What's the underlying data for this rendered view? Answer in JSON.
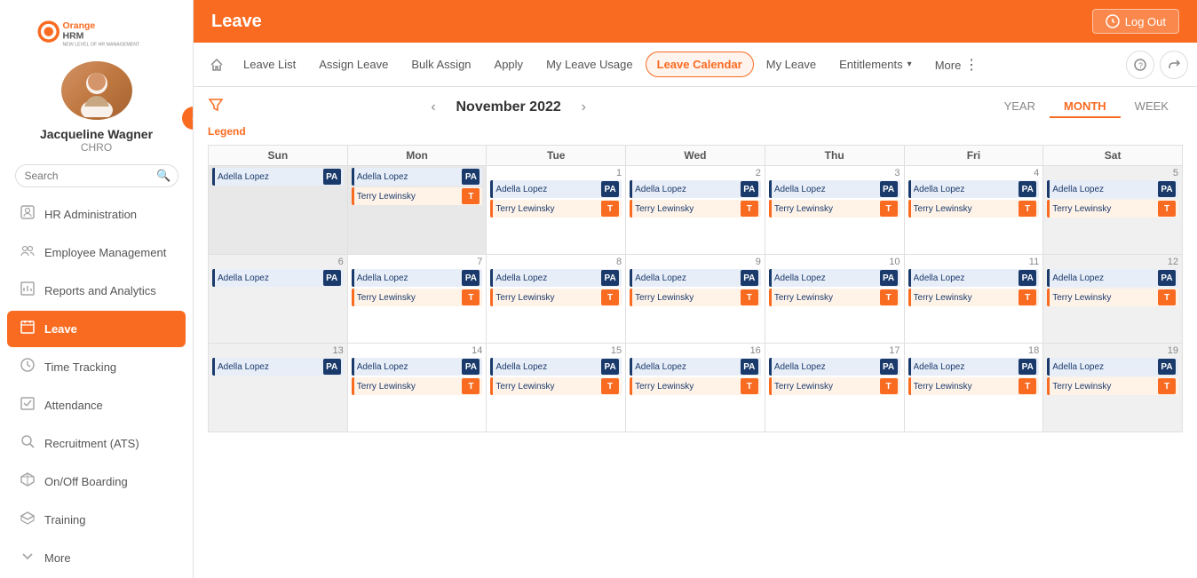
{
  "app": {
    "title": "Leave",
    "logo_text": "OrangeHRM"
  },
  "header": {
    "logout_label": "Log Out"
  },
  "user": {
    "name": "Jacqueline Wagner",
    "role": "CHRO"
  },
  "search": {
    "placeholder": "Search"
  },
  "nav": {
    "items": [
      {
        "id": "hr-admin",
        "label": "HR Administration",
        "icon": "🏠"
      },
      {
        "id": "emp-mgmt",
        "label": "Employee Management",
        "icon": "👥"
      },
      {
        "id": "reports",
        "label": "Reports and Analytics",
        "icon": "📊"
      },
      {
        "id": "leave",
        "label": "Leave",
        "icon": "📅"
      },
      {
        "id": "time",
        "label": "Time Tracking",
        "icon": "⏱"
      },
      {
        "id": "attendance",
        "label": "Attendance",
        "icon": "📋"
      },
      {
        "id": "recruitment",
        "label": "Recruitment (ATS)",
        "icon": "🔍"
      },
      {
        "id": "onboarding",
        "label": "On/Off Boarding",
        "icon": "🔄"
      },
      {
        "id": "training",
        "label": "Training",
        "icon": "🎓"
      },
      {
        "id": "more",
        "label": "More",
        "icon": "⌄"
      }
    ]
  },
  "tabs": {
    "items": [
      {
        "id": "leave-list",
        "label": "Leave List"
      },
      {
        "id": "assign-leave",
        "label": "Assign Leave"
      },
      {
        "id": "bulk-assign",
        "label": "Bulk Assign"
      },
      {
        "id": "apply",
        "label": "Apply"
      },
      {
        "id": "my-leave-usage",
        "label": "My Leave Usage"
      },
      {
        "id": "leave-calendar",
        "label": "Leave Calendar"
      },
      {
        "id": "my-leave",
        "label": "My Leave"
      },
      {
        "id": "entitlements",
        "label": "Entitlements"
      },
      {
        "id": "more",
        "label": "More"
      }
    ]
  },
  "calendar": {
    "month_label": "November 2022",
    "legend_label": "Legend",
    "views": [
      "YEAR",
      "MONTH",
      "WEEK"
    ],
    "active_view": "MONTH",
    "days_header": [
      "Sun",
      "Mon",
      "Tue",
      "Wed",
      "Thu",
      "Fri",
      "Sat"
    ],
    "weeks": [
      {
        "days": [
          {
            "num": "",
            "inactive": true,
            "entries": [
              {
                "name": "Adella Lopez",
                "badge": "PA",
                "type": "pa"
              }
            ]
          },
          {
            "num": "",
            "inactive": true,
            "entries": [
              {
                "name": "Adella Lopez",
                "badge": "PA",
                "type": "pa"
              },
              {
                "name": "Terry Lewinsky",
                "badge": "T",
                "type": "t"
              }
            ]
          },
          {
            "num": "1",
            "entries": [
              {
                "name": "Adella Lopez",
                "badge": "PA",
                "type": "pa"
              },
              {
                "name": "Terry Lewinsky",
                "badge": "T",
                "type": "t"
              }
            ]
          },
          {
            "num": "2",
            "entries": [
              {
                "name": "Adella Lopez",
                "badge": "PA",
                "type": "pa"
              },
              {
                "name": "Terry Lewinsky",
                "badge": "T",
                "type": "t"
              }
            ]
          },
          {
            "num": "3",
            "entries": [
              {
                "name": "Adella Lopez",
                "badge": "PA",
                "type": "pa"
              },
              {
                "name": "Terry Lewinsky",
                "badge": "T",
                "type": "t"
              }
            ]
          },
          {
            "num": "4",
            "entries": [
              {
                "name": "Adella Lopez",
                "badge": "PA",
                "type": "pa"
              },
              {
                "name": "Terry Lewinsky",
                "badge": "T",
                "type": "t"
              }
            ]
          },
          {
            "num": "5",
            "weekend": true,
            "entries": [
              {
                "name": "Adella Lopez",
                "badge": "PA",
                "type": "pa"
              },
              {
                "name": "Terry Lewinsky",
                "badge": "T",
                "type": "t"
              }
            ]
          }
        ]
      },
      {
        "days": [
          {
            "num": "6",
            "weekend": true,
            "entries": [
              {
                "name": "Adella Lopez",
                "badge": "PA",
                "type": "pa"
              }
            ]
          },
          {
            "num": "7",
            "entries": [
              {
                "name": "Adella Lopez",
                "badge": "PA",
                "type": "pa"
              },
              {
                "name": "Terry Lewinsky",
                "badge": "T",
                "type": "t"
              }
            ]
          },
          {
            "num": "8",
            "entries": [
              {
                "name": "Adella Lopez",
                "badge": "PA",
                "type": "pa"
              },
              {
                "name": "Terry Lewinsky",
                "badge": "T",
                "type": "t"
              }
            ]
          },
          {
            "num": "9",
            "entries": [
              {
                "name": "Adella Lopez",
                "badge": "PA",
                "type": "pa"
              },
              {
                "name": "Terry Lewinsky",
                "badge": "T",
                "type": "t"
              }
            ]
          },
          {
            "num": "10",
            "entries": [
              {
                "name": "Adella Lopez",
                "badge": "PA",
                "type": "pa"
              },
              {
                "name": "Terry Lewinsky",
                "badge": "T",
                "type": "t"
              }
            ]
          },
          {
            "num": "11",
            "entries": [
              {
                "name": "Adella Lopez",
                "badge": "PA",
                "type": "pa"
              },
              {
                "name": "Terry Lewinsky",
                "badge": "T",
                "type": "t"
              }
            ]
          },
          {
            "num": "12",
            "weekend": true,
            "entries": [
              {
                "name": "Adella Lopez",
                "badge": "PA",
                "type": "pa"
              },
              {
                "name": "Terry Lewinsky",
                "badge": "T",
                "type": "t"
              }
            ]
          }
        ]
      },
      {
        "days": [
          {
            "num": "13",
            "weekend": true,
            "entries": [
              {
                "name": "Adella Lopez",
                "badge": "PA",
                "type": "pa"
              }
            ]
          },
          {
            "num": "14",
            "entries": [
              {
                "name": "Adella Lopez",
                "badge": "PA",
                "type": "pa"
              },
              {
                "name": "Terry Lewinsky",
                "badge": "T",
                "type": "t"
              }
            ]
          },
          {
            "num": "15",
            "entries": [
              {
                "name": "Adella Lopez",
                "badge": "PA",
                "type": "pa"
              },
              {
                "name": "Terry Lewinsky",
                "badge": "T",
                "type": "t"
              }
            ]
          },
          {
            "num": "16",
            "entries": [
              {
                "name": "Adella Lopez",
                "badge": "PA",
                "type": "pa"
              },
              {
                "name": "Terry Lewinsky",
                "badge": "T",
                "type": "t"
              }
            ]
          },
          {
            "num": "17",
            "entries": [
              {
                "name": "Adella Lopez",
                "badge": "PA",
                "type": "pa"
              },
              {
                "name": "Terry Lewinsky",
                "badge": "T",
                "type": "t"
              }
            ]
          },
          {
            "num": "18",
            "entries": [
              {
                "name": "Adella Lopez",
                "badge": "PA",
                "type": "pa"
              },
              {
                "name": "Terry Lewinsky",
                "badge": "T",
                "type": "t"
              }
            ]
          },
          {
            "num": "19",
            "weekend": true,
            "entries": [
              {
                "name": "Adella Lopez",
                "badge": "PA",
                "type": "pa"
              },
              {
                "name": "Terry Lewinsky",
                "badge": "T",
                "type": "t"
              }
            ]
          }
        ]
      }
    ]
  }
}
